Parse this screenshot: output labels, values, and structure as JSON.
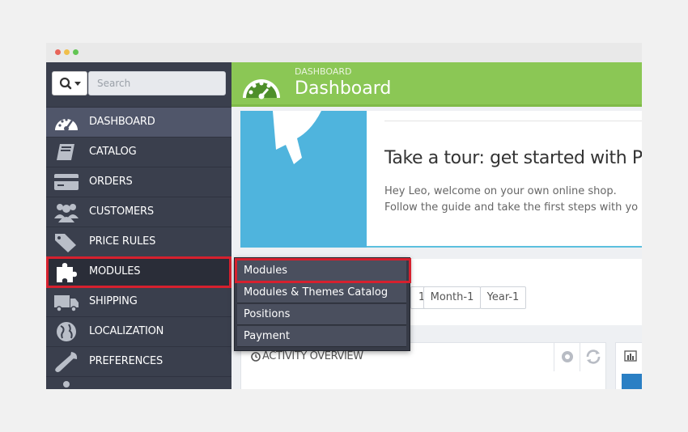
{
  "window": {
    "traffic_lights": [
      "#e8655a",
      "#f0bf4c",
      "#62c554"
    ]
  },
  "search": {
    "placeholder": "Search"
  },
  "sidebar": {
    "items": [
      {
        "label": "DASHBOARD",
        "icon": "dashboard-icon",
        "active": true
      },
      {
        "label": "CATALOG",
        "icon": "book-icon"
      },
      {
        "label": "ORDERS",
        "icon": "credit-card-icon"
      },
      {
        "label": "CUSTOMERS",
        "icon": "users-icon"
      },
      {
        "label": "PRICE RULES",
        "icon": "tags-icon"
      },
      {
        "label": "MODULES",
        "icon": "puzzle-icon",
        "highlighted": true
      },
      {
        "label": "SHIPPING",
        "icon": "truck-icon"
      },
      {
        "label": "LOCALIZATION",
        "icon": "globe-icon"
      },
      {
        "label": "PREFERENCES",
        "icon": "wrench-icon"
      }
    ]
  },
  "header": {
    "breadcrumb": "DASHBOARD",
    "title": "Dashboard",
    "color": "#8bc755"
  },
  "tour": {
    "title": "Take a tour: get started with Pr",
    "line1": "Hey Leo, welcome on your own online shop.",
    "line2": "Follow the guide and take the first steps with yo"
  },
  "filters": {
    "items": [
      "1",
      "Month-1",
      "Year-1"
    ]
  },
  "activity": {
    "title": "ACTIVITY OVERVIEW"
  },
  "modules_menu": {
    "items": [
      "Modules",
      "Modules & Themes Catalog",
      "Positions",
      "Payment"
    ]
  },
  "colors": {
    "highlight_red": "#d6202e",
    "sidebar_bg": "#3a3f4d",
    "tour_blue": "#4fb4dd"
  }
}
